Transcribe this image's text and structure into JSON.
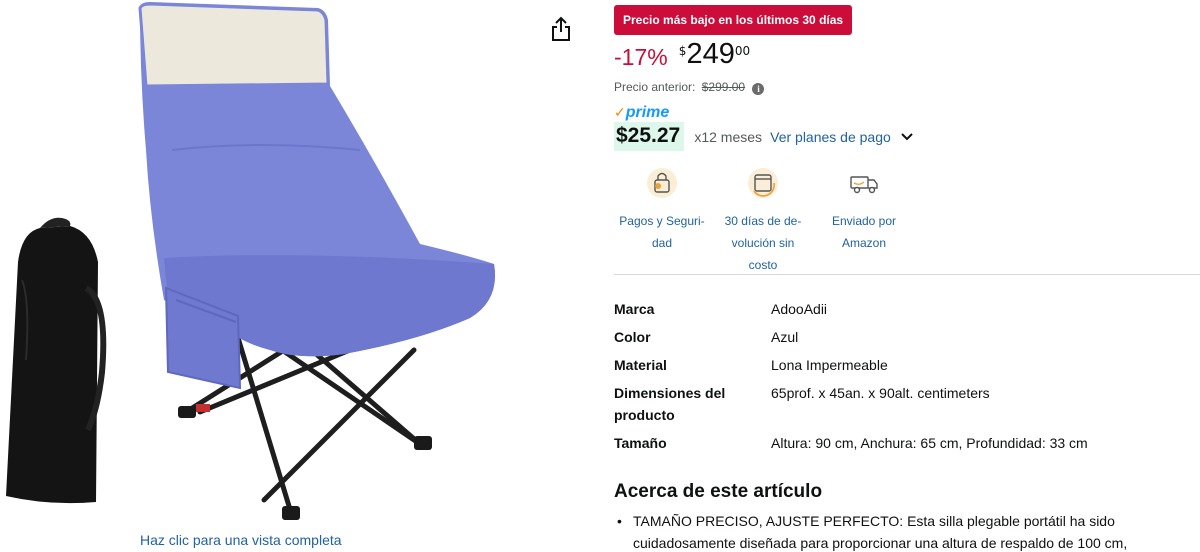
{
  "gallery": {
    "view_full_link": "Haz clic para una vista completa",
    "share_icon": "share-icon"
  },
  "deal": {
    "badge": "Precio más bajo en los últimos 30 días"
  },
  "price": {
    "discount": "-17%",
    "currency_symbol": "$",
    "whole": "249",
    "fraction": "00",
    "previous_label": "Precio anterior:",
    "previous_value": "$299.00",
    "info_icon": "i"
  },
  "prime": {
    "check": "✓",
    "label": "prime"
  },
  "installments": {
    "amount": "$25.27",
    "months": "x12 meses",
    "plans_link": "Ver planes de pago"
  },
  "features": [
    {
      "label_line1": "Pagos y Seguri-",
      "label_line2": "dad",
      "icon": "secure-payment-icon"
    },
    {
      "label_line1": "30 días de de-",
      "label_line2": "volución sin",
      "label_line3": "costo",
      "icon": "returns-icon"
    },
    {
      "label_line1": "Enviado por",
      "label_line2": "Amazon",
      "icon": "delivery-truck-icon"
    }
  ],
  "specs": [
    {
      "key": "Marca",
      "value": "AdooAdii"
    },
    {
      "key": "Color",
      "value": "Azul"
    },
    {
      "key": "Material",
      "value": "Lona Impermeable"
    },
    {
      "key_line1": "Dimensiones del",
      "key_line2": "producto",
      "value": "65prof. x 45an. x 90alt. centimeters"
    },
    {
      "key": "Tamaño",
      "value": "Altura: 90 cm, Anchura: 65 cm, Profundidad: 33 cm"
    }
  ],
  "about": {
    "title": "Acerca de este artículo",
    "bullet_dot": "•",
    "bullet_line1": "TAMAÑO PRECISO, AJUSTE PERFECTO: Esta silla plegable portátil ha sido",
    "bullet_line2": "cuidadosamente diseñada para proporcionar una altura de respaldo de 100 cm,"
  },
  "colors": {
    "deal_red": "#cc0c39",
    "link_blue": "#2162a1",
    "prime_blue": "#1399ff",
    "installment_bg": "#ddf7ea",
    "chair_blue": "#7b86d8"
  }
}
